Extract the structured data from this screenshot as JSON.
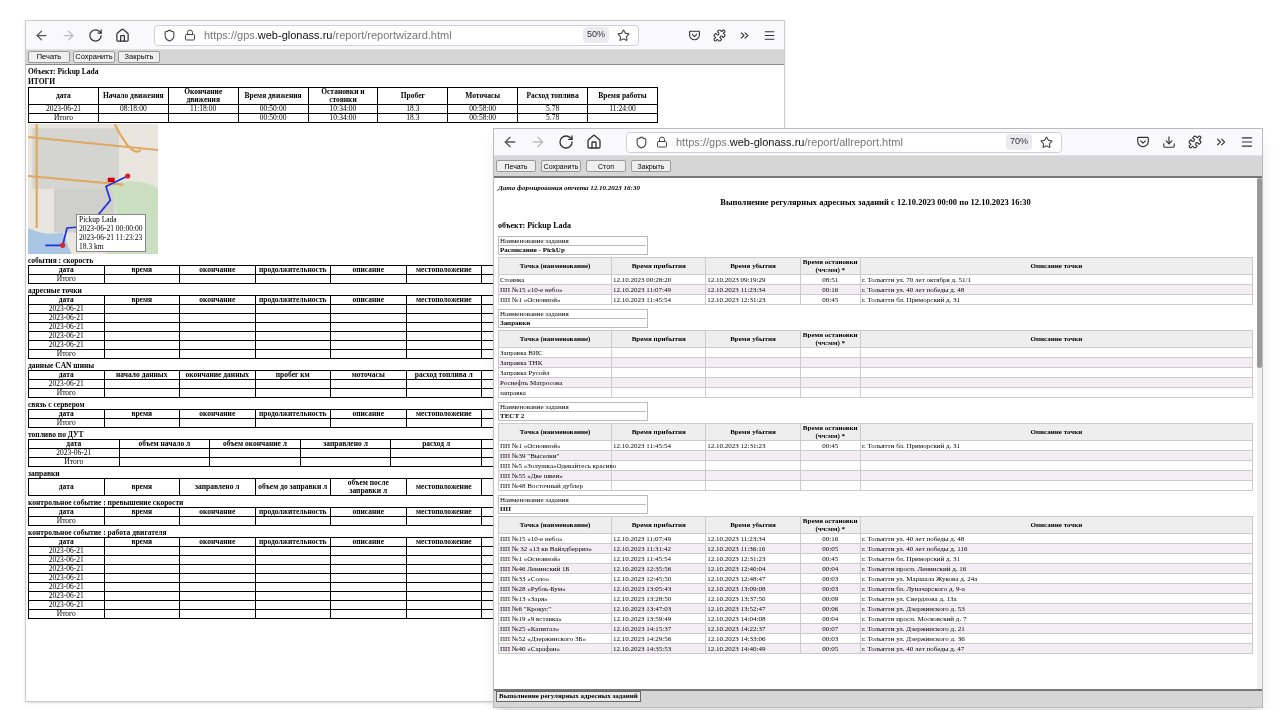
{
  "back_window": {
    "nav": {
      "forward_disabled": true
    },
    "url": {
      "scheme": "https://gps.",
      "host": "web-glonass.ru",
      "path": "/report/reportwizard.html"
    },
    "zoom": "50%",
    "buttons": [
      "Печать",
      "Сохранить",
      "Закрыть"
    ],
    "object": "Объект: Pickup Lada",
    "summary": {
      "title": "ИТОГИ",
      "columns": [
        "дата",
        "Начало движения",
        "Окончание движения",
        "Время движения",
        "Остановки и стоянки",
        "Пробег",
        "Моточасы",
        "Расход топлива",
        "Время работы"
      ],
      "rows": [
        [
          "2023-06-21",
          "08:18:00",
          "11:18:00",
          "00:50:00",
          "10:34:00",
          "18.3",
          "00:58:00",
          "5.78",
          "11:24:00"
        ],
        [
          "Итого",
          null,
          null,
          "00:50:00",
          "10:34:00",
          "18.3",
          "00:58:00",
          "5.78",
          null
        ]
      ]
    },
    "map": {
      "popup": [
        "Pickup Lada",
        "2023-06-21 00:00:00",
        "2023-06-21 11:23:23",
        "18.3 km"
      ]
    },
    "sections": [
      {
        "title": "события : скорость",
        "columns": [
          "дата",
          "время",
          "окончание",
          "продолжительность",
          "описание",
          "местоположение"
        ],
        "rows": [
          [
            "Итого"
          ]
        ]
      },
      {
        "title": "адресные точки",
        "columns": [
          "дата",
          "время",
          "окончание",
          "продолжительность",
          "описание",
          "местоположение"
        ],
        "rows": [
          [
            "2023-06-21"
          ],
          [
            "2023-06-21"
          ],
          [
            "2023-06-21"
          ],
          [
            "2023-06-21"
          ],
          [
            "2023-06-21"
          ],
          [
            "Итого"
          ]
        ]
      },
      {
        "title": "данные CAN шины",
        "columns": [
          "дата",
          "начало данных",
          "окончание данных",
          "пробег км",
          "моточасы",
          "расход топлива л"
        ],
        "rows": [
          [
            "2023-06-21"
          ],
          [
            "Итого"
          ]
        ]
      },
      {
        "title": "связь с сервером",
        "columns": [
          "дата",
          "время",
          "окончание",
          "продолжительность",
          "описание",
          "местоположение"
        ],
        "rows": [
          [
            "Итого"
          ]
        ]
      },
      {
        "title": "топливо по ДУТ",
        "columns": [
          "дата",
          "объем начало л",
          "объем окончание л",
          "заправлено л",
          "расход л"
        ],
        "rows": [
          [
            "2023-06-21"
          ],
          [
            "Итого"
          ]
        ]
      },
      {
        "title": "заправки",
        "columns": [
          "дата",
          "время",
          "заправлено л",
          "объем до заправки л",
          "объем после заправки л",
          "местоположение"
        ]
      },
      {
        "title": "контрольное событие : превышение скорости",
        "columns": [
          "дата",
          "время",
          "окончание",
          "продолжительность",
          "описание",
          "местоположение"
        ],
        "rows": [
          [
            "Итого"
          ]
        ]
      },
      {
        "title": "контрольное событие : работа двигателя",
        "columns": [
          "дата",
          "время",
          "окончание",
          "продолжительность",
          "описание",
          "местоположение"
        ],
        "rows": [
          [
            "2023-06-21"
          ],
          [
            "2023-06-21"
          ],
          [
            "2023-06-21"
          ],
          [
            "2023-06-21"
          ],
          [
            "2023-06-21"
          ],
          [
            "2023-06-21"
          ],
          [
            "2023-06-21"
          ],
          [
            "Итого"
          ]
        ]
      }
    ]
  },
  "front_window": {
    "nav": {
      "forward_disabled": true
    },
    "url": {
      "scheme": "https://gps.",
      "host": "web-glonass.ru",
      "path": "/report/allreport.html"
    },
    "zoom": "70%",
    "buttons": [
      "Печать",
      "Сохранить",
      "Стоп",
      "Закрыть"
    ],
    "report_date": "Дата формирования отчета 12.10.2023 16:30",
    "title": "Выполнение регулярных адресных заданий с 12.10.2023 00:00 по 12.10.2023 16:30",
    "object": "объект: Pickup Lada",
    "tasks": [
      {
        "label": "Наименование задания",
        "name": "Расписание - PickUp",
        "columns": [
          "Точка (наименование)",
          "Время прибытия",
          "Время убытия",
          "Время остановки (чч:мм) *",
          "Описание точки"
        ],
        "rows": [
          [
            "Стоянка",
            "12.10.2023 00:28:20",
            "12.10.2023 09:19:29",
            "08:51",
            "г. Тольятти ул. 70 лет октября д. 51/1"
          ],
          [
            "ПП №15 «10-е небо»",
            "12.10.2023 11:07:49",
            "12.10.2023 11:23:34",
            "00:16",
            "г. Тольятти ул. 40 лет победы д. 48"
          ],
          [
            "ПП №1 «Основной»",
            "12.10.2023 11:45:54",
            "12.10.2023 12:31:23",
            "00:45",
            "г. Тольятти бл. Приморский д. 31"
          ]
        ]
      },
      {
        "label": "Наименование задания",
        "name": "Заправки",
        "columns": [
          "Точка (наименование)",
          "Время прибытия",
          "Время убытия",
          "Время остановки (чч:мм) *",
          "Описание точки"
        ],
        "rows": [
          [
            "Заправка ВИС"
          ],
          [
            "Заправка ТНК"
          ],
          [
            "Заправка Русойл"
          ],
          [
            "Роснефть Матросова"
          ],
          [
            "заправка"
          ]
        ]
      },
      {
        "label": "Наименование задания",
        "name": "ТЕСТ 2",
        "columns": [
          "Точка (наименование)",
          "Время прибытия",
          "Время убытия",
          "Время остановки (чч:мм) *",
          "Описание точки"
        ],
        "rows": [
          [
            "ПП №1 «Основной»",
            "12.10.2023 11:45:54",
            "12.10.2023 12:31:23",
            "00:45",
            "г. Тольятти бл. Приморский д. 31"
          ],
          [
            "ПП №39 \"Выселки\""
          ],
          [
            "ПП №5 «Золушка»Одевайтесь красиво"
          ],
          [
            "ПП №55 «Две швеи»"
          ],
          [
            "ПП №48 Восточный дублер"
          ]
        ]
      },
      {
        "label": "Наименование задания",
        "name": "ПП",
        "columns": [
          "Точка (наименование)",
          "Время прибытия",
          "Время убытия",
          "Время остановки (чч:мм) *",
          "Описание точки"
        ],
        "rows": [
          [
            "ПП №15 «10-е небо»",
            "12.10.2023 11:07:49",
            "12.10.2023 11:23:34",
            "00:16",
            "г. Тольятти ул. 40 лет победы д. 48"
          ],
          [
            "ПП № 32 «13 кв Вайлдберриз»",
            "12.10.2023 11:31:42",
            "12.10.2023 11:36:16",
            "00:05",
            "г. Тольятти ул. 40 лет победы д. 116"
          ],
          [
            "ПП №1 «Основной»",
            "12.10.2023 11:45:54",
            "12.10.2023 12:31:23",
            "00:45",
            "г. Тольятти бл. Приморский д. 31"
          ],
          [
            "ПП №46 Ленинский 1Б",
            "12.10.2023 12:35:56",
            "12.10.2023 12:40:04",
            "00:04",
            "г. Тольятти просп. Ленинский д. 16"
          ],
          [
            "ПП №33 «Соло»",
            "12.10.2023 12:45:50",
            "12.10.2023 12:48:47",
            "00:03",
            "г. Тольятти ул. Маршала Жукова д. 24а"
          ],
          [
            "ПП №28 «Рубль-Бум»",
            "12.10.2023 13:05:43",
            "12.10.2023 13:09:08",
            "00:03",
            "г. Тольятти бл. Луначарского д. 9-а"
          ],
          [
            "ПП №13 «Заря»",
            "12.10.2023 13:28:50",
            "12.10.2023 13:37:50",
            "00:09",
            "г. Тольятти ул. Свердлова д. 13а"
          ],
          [
            "ПП №6 \"Крокус\"",
            "12.10.2023 13:47:03",
            "12.10.2023 13:52:47",
            "00:06",
            "г. Тольятти ул. Дзержинского д. 53"
          ],
          [
            "ПП №19 «9 вставка»",
            "12.10.2023 13:59:49",
            "12.10.2023 14:04:08",
            "00:04",
            "г. Тольятти просп. Московский д. 7"
          ],
          [
            "ПП №25 «Капитал»",
            "12.10.2023 14:15:37",
            "12.10.2023 14:22:37",
            "00:07",
            "г. Тольятти ул. Дзержинского д. 21"
          ],
          [
            "ПП №52 «Дзержинского 3Б»",
            "12.10.2023 14:29:56",
            "12.10.2023 14:33:06",
            "00:03",
            "г. Тольятти ул. Дзержинского д. 36"
          ],
          [
            "ПП №40 «Сарафан»",
            "12.10.2023 14:35:53",
            "12.10.2023 14:40:49",
            "00:05",
            "г. Тольятти ул. 40 лет победы д. 47"
          ]
        ]
      }
    ],
    "bottom_tab": "Выполнение регулярных адресных заданий"
  }
}
